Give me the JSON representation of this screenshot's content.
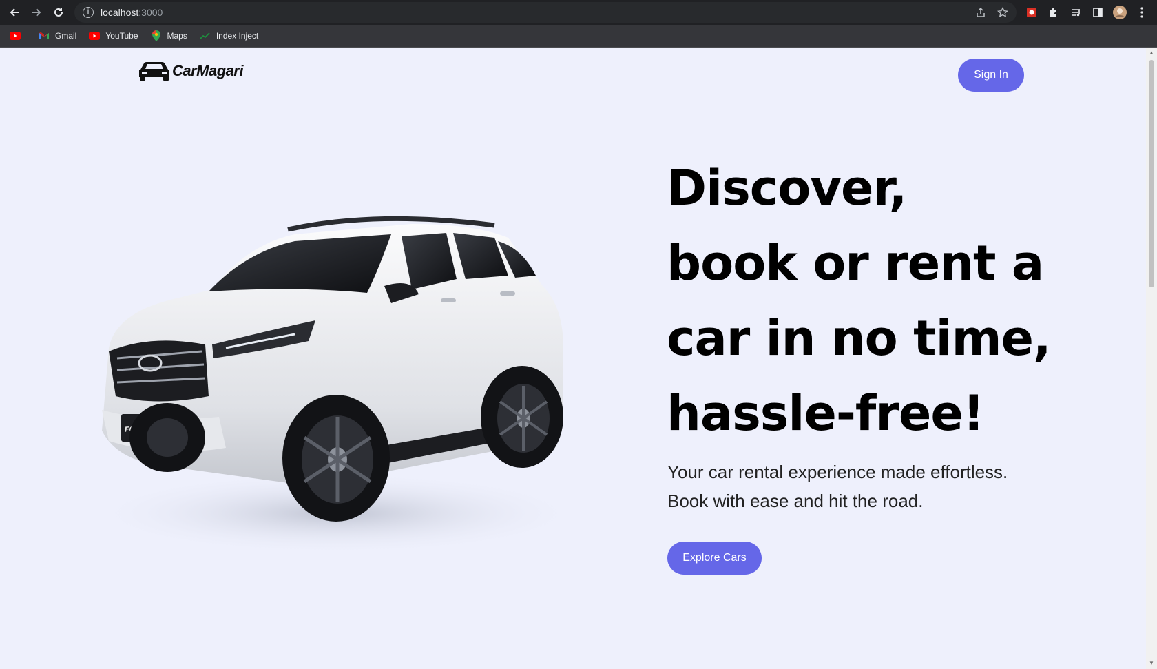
{
  "browser": {
    "url_host": "localhost",
    "url_port": ":3000",
    "bookmarks": [
      {
        "label": "",
        "icon": "youtube-icon"
      },
      {
        "label": "Gmail",
        "icon": "gmail-icon"
      },
      {
        "label": "YouTube",
        "icon": "youtube-icon"
      },
      {
        "label": "Maps",
        "icon": "maps-icon"
      },
      {
        "label": "Index Inject",
        "icon": "chart-trend-icon"
      }
    ]
  },
  "header": {
    "logo_text": "CarMagari",
    "signin_label": "Sign In"
  },
  "hero": {
    "title": "Discover, book or rent a car in no time, hassle-free!",
    "subtitle": "Your car rental experience made effortless. Book with ease and hit the road.",
    "cta_label": "Explore Cars",
    "car_badge": "FORTUNER"
  },
  "colors": {
    "accent": "#6567e8",
    "page_bg": "#eef0fc"
  }
}
